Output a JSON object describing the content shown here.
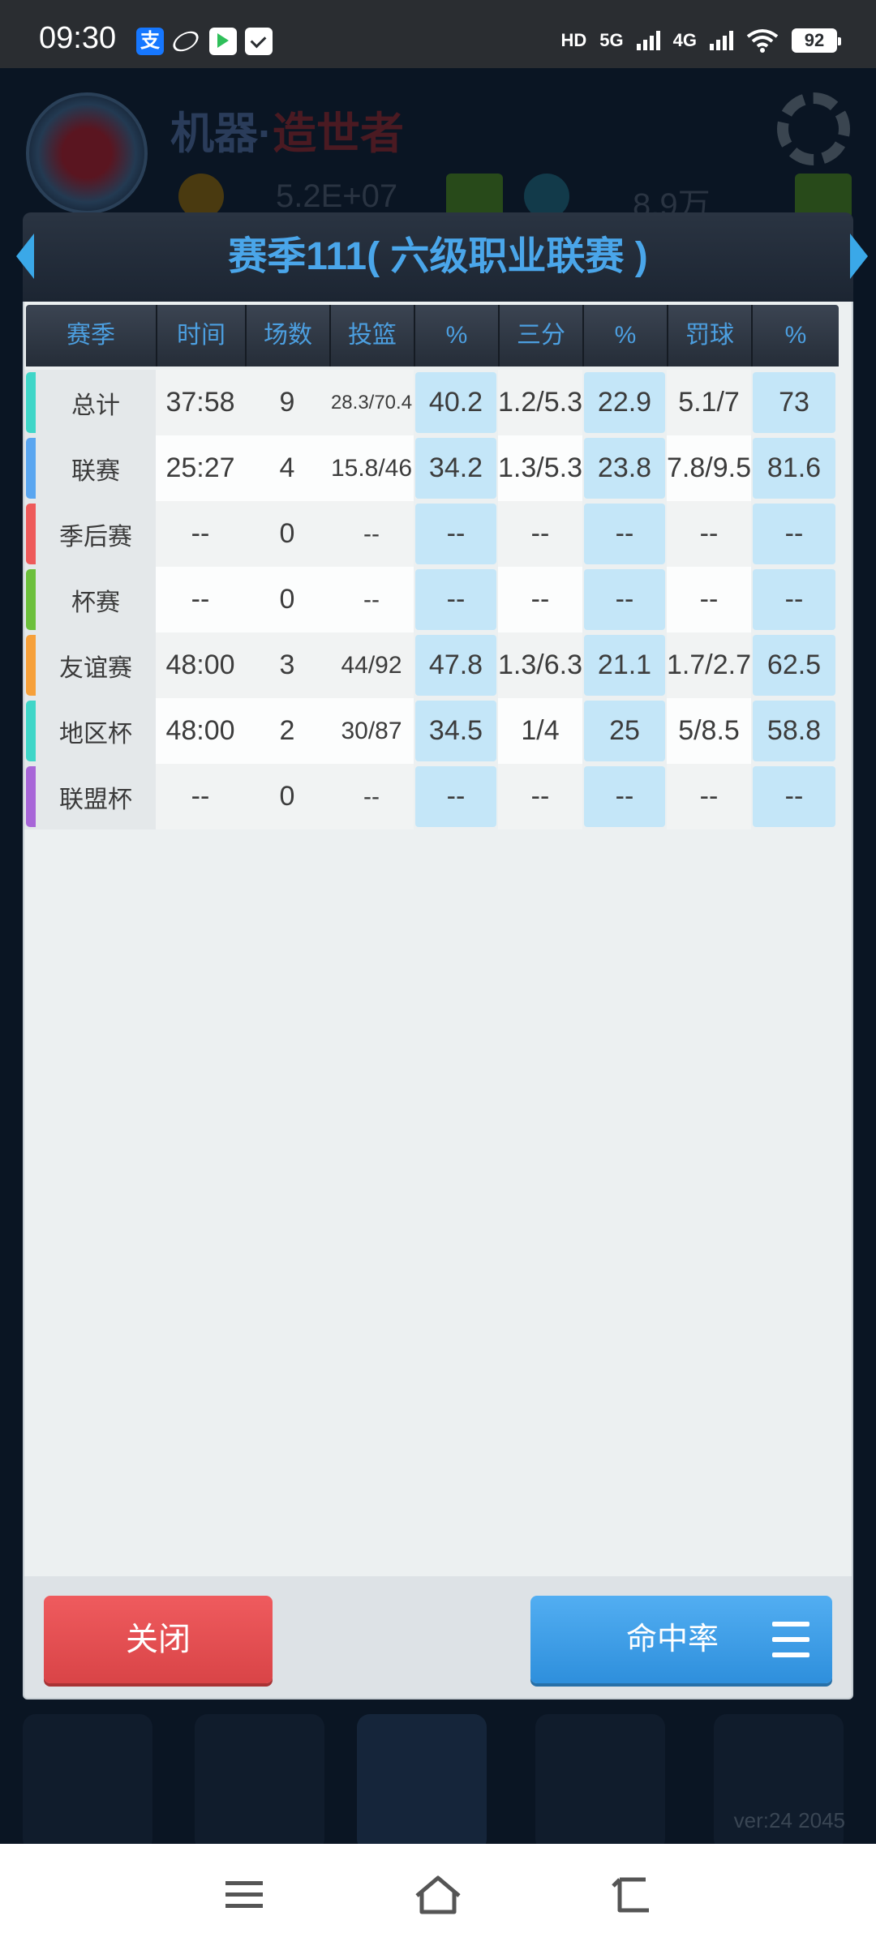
{
  "status_bar": {
    "time": "09:30",
    "alipay_glyph": "支",
    "hd_label": "HD",
    "net_5g": "5G",
    "net_4g": "4G",
    "battery": "92"
  },
  "background": {
    "title_a": "机器·",
    "title_b": "造世者",
    "stat_a": "5.2E+07",
    "stat_b": "8.9万",
    "version": "ver:24 2045"
  },
  "modal": {
    "title": "赛季111( 六级职业联赛 )",
    "columns": [
      "赛季",
      "时间",
      "场数",
      "投篮",
      "%",
      "三分",
      "%",
      "罚球",
      "%"
    ],
    "rows": [
      {
        "name": "总计",
        "color": "#3fd6c8",
        "time": "37:58",
        "games": "9",
        "fg": "28.3/70.4",
        "fg_pct": "40.2",
        "three": "1.2/5.3",
        "three_pct": "22.9",
        "ft": "5.1/7",
        "ft_pct": "73"
      },
      {
        "name": "联赛",
        "color": "#5aa6f0",
        "time": "25:27",
        "games": "4",
        "fg": "15.8/46",
        "fg_pct": "34.2",
        "three": "1.3/5.3",
        "three_pct": "23.8",
        "ft": "7.8/9.5",
        "ft_pct": "81.6"
      },
      {
        "name": "季后赛",
        "color": "#ee5a5a",
        "time": "--",
        "games": "0",
        "fg": "--",
        "fg_pct": "--",
        "three": "--",
        "three_pct": "--",
        "ft": "--",
        "ft_pct": "--"
      },
      {
        "name": "杯赛",
        "color": "#6cc03c",
        "time": "--",
        "games": "0",
        "fg": "--",
        "fg_pct": "--",
        "three": "--",
        "three_pct": "--",
        "ft": "--",
        "ft_pct": "--"
      },
      {
        "name": "友谊赛",
        "color": "#f6a03a",
        "time": "48:00",
        "games": "3",
        "fg": "44/92",
        "fg_pct": "47.8",
        "three": "1.3/6.3",
        "three_pct": "21.1",
        "ft": "1.7/2.7",
        "ft_pct": "62.5"
      },
      {
        "name": "地区杯",
        "color": "#3fd6c8",
        "time": "48:00",
        "games": "2",
        "fg": "30/87",
        "fg_pct": "34.5",
        "three": "1/4",
        "three_pct": "25",
        "ft": "5/8.5",
        "ft_pct": "58.8"
      },
      {
        "name": "联盟杯",
        "color": "#a866d8",
        "time": "--",
        "games": "0",
        "fg": "--",
        "fg_pct": "--",
        "three": "--",
        "three_pct": "--",
        "ft": "--",
        "ft_pct": "--"
      }
    ],
    "close_label": "关闭",
    "hit_rate_label": "命中率"
  },
  "nav_bar": {
    "icons": [
      "menu-icon",
      "home-icon",
      "back-icon"
    ]
  }
}
